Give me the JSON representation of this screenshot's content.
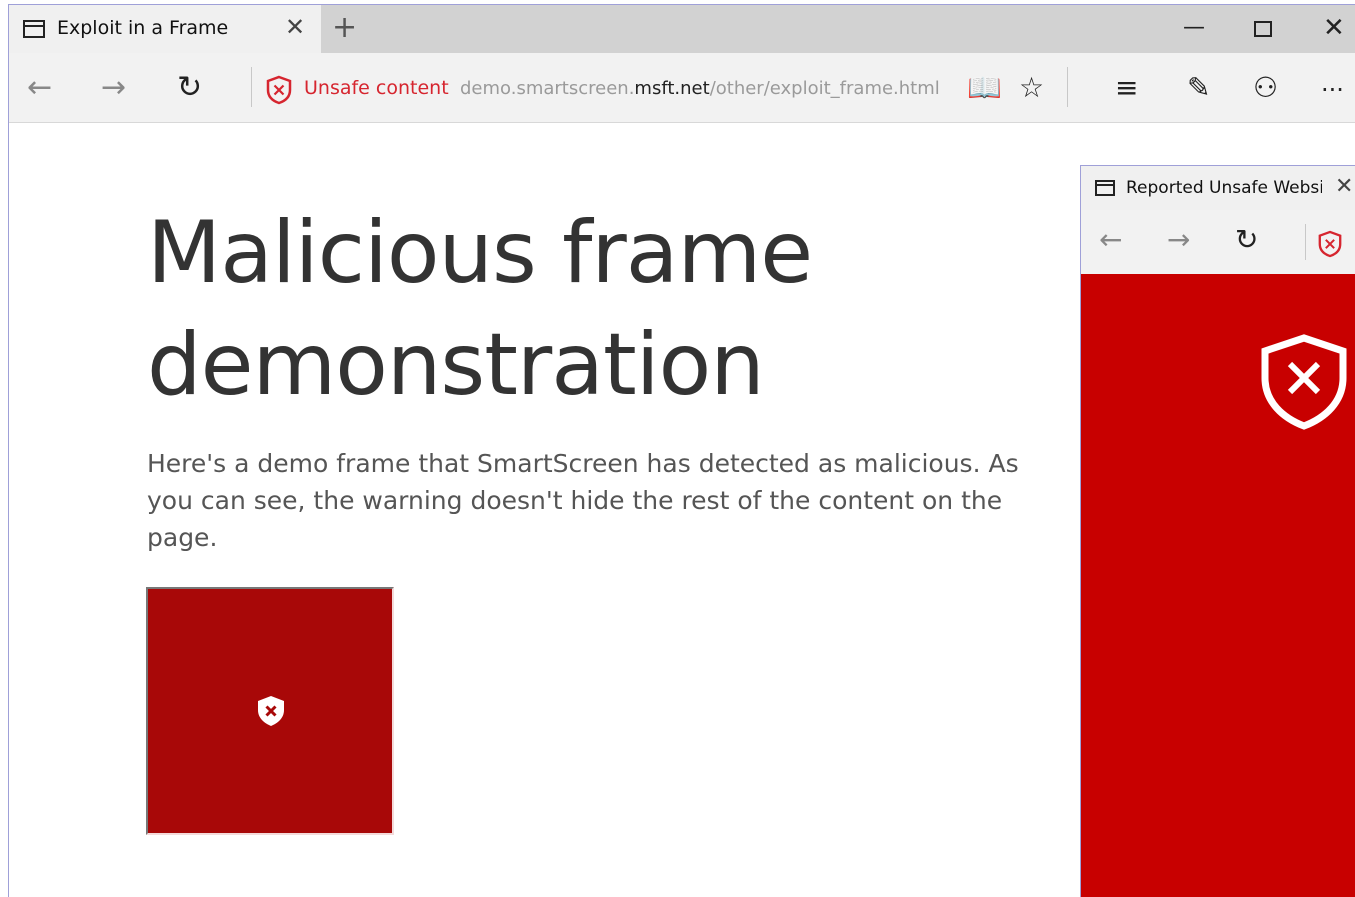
{
  "tab": {
    "title": "Exploit in a Frame",
    "close": "✕",
    "new_tab": "+"
  },
  "window_controls": {
    "minimize": "—",
    "close": "✕"
  },
  "toolbar": {
    "back": "←",
    "forward": "→",
    "refresh": "↻",
    "security_label": "Unsafe content",
    "url_prefix": "demo.smartscreen.",
    "url_domain": "msft.net",
    "url_path": "/other/exploit_frame.html",
    "reading_view": "📖",
    "favorite": "☆",
    "hub": "≡",
    "web_note": "✎",
    "share": "⚇",
    "more": "···"
  },
  "page": {
    "headline": "Malicious frame demonstration",
    "description": "Here's a demo frame that SmartScreen has detected as malicious. As you can see, the warning doesn't hide the rest of the content on the page."
  },
  "popup": {
    "tab_title": "Reported Unsafe Website",
    "close": "✕",
    "back": "←",
    "forward": "→",
    "refresh": "↻"
  },
  "colors": {
    "danger": "#d6252f",
    "frame_red": "#a80808",
    "popup_red": "#c80000"
  }
}
